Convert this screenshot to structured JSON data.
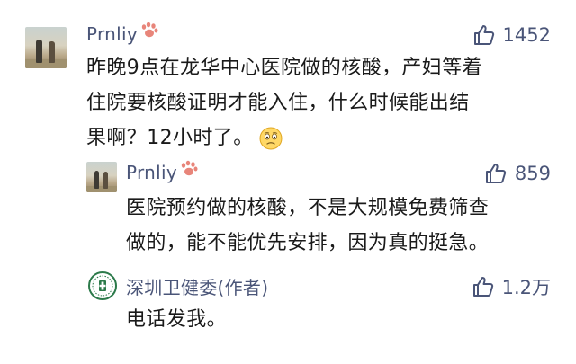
{
  "comment": {
    "author": "Prnliy",
    "likes": "1452",
    "text_lines": [
      "昨晚9点在龙华中心医院做的核酸，产妇等着",
      "住院要核酸证明才能入住，什么时候能出结",
      "果啊？12小时了。"
    ]
  },
  "reply1": {
    "author": "Prnliy",
    "likes": "859",
    "text_lines": [
      "医院预约做的核酸，不是大规模免费筛查",
      "做的，能不能优先安排，因为真的挺急。"
    ]
  },
  "reply2": {
    "author": "深圳卫健委(作者)",
    "likes": "1.2万",
    "text": "电话发我。"
  },
  "icons": {
    "like": "thumbs-up-icon",
    "paw": "paw-icon",
    "emoji": "sad-face-emoji-icon"
  },
  "colors": {
    "name": "#4a5578",
    "paw": "#e8857a",
    "org_green": "#2c7a4a"
  }
}
